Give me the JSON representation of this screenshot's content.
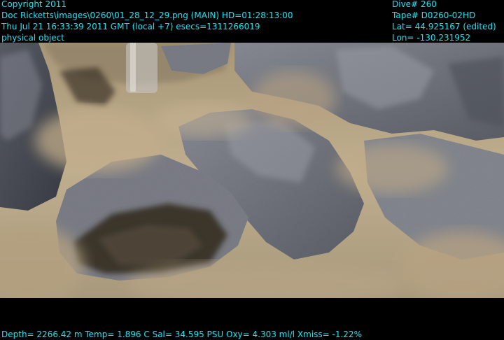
{
  "overlay": {
    "top_left": {
      "line1": "Copyright 2011",
      "line2": "Doc Ricketts\\images\\0260\\01_28_12_29.png (MAIN)  HD=01:28:13:00",
      "line3": "Thu Jul 21 16:33:39 2011 GMT (local +7)  esecs=1311266019",
      "line4": "physical object"
    },
    "top_right": {
      "line1": "Dive# 260",
      "line2": "Tape# D0260-02HD",
      "line3": "Lat= 44.925167 (edited)",
      "line4": "Lon= -130.231952"
    },
    "bottom": {
      "telemetry": "Depth= 2266.42 m  Temp= 1.896 C  Sal= 34.595 PSU  Oxy= 4.303 ml/l  Xmiss= -1.22%"
    }
  },
  "colors": {
    "overlay_text": "#18e6f2",
    "background": "#000000",
    "sediment": "#b9a789",
    "rock": "#6e7078"
  }
}
